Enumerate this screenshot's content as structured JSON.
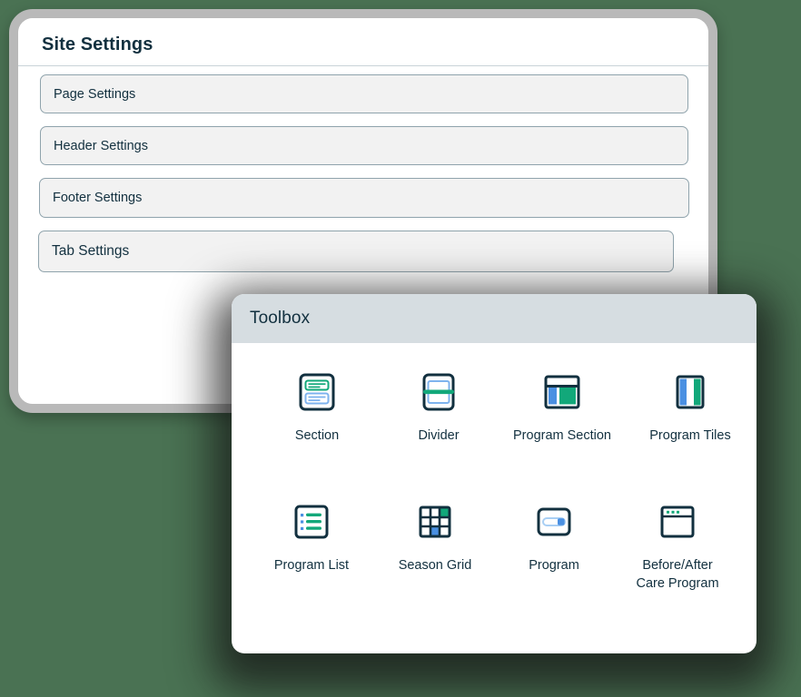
{
  "theme": {
    "page_background": "#4a7253",
    "panel_background": "#ffffff",
    "device_frame": "#b9b9b9",
    "toolbox_header_background": "#d6dde1",
    "text_dark": "#12303f",
    "button_background": "#f2f2f2",
    "button_border": "#8fa3ac",
    "accent_green": "#12a87a",
    "accent_blue": "#4a90e2",
    "icon_outline": "#12303f"
  },
  "site_settings": {
    "title": "Site Settings",
    "items": [
      {
        "label": "Page Settings",
        "name": "page-settings"
      },
      {
        "label": "Header Settings",
        "name": "header-settings"
      },
      {
        "label": "Footer Settings",
        "name": "footer-settings"
      },
      {
        "label": "Tab Settings",
        "name": "tab-settings"
      }
    ]
  },
  "toolbox": {
    "title": "Toolbox",
    "rows": [
      {
        "tools": [
          {
            "label": "Section",
            "icon": "section-icon"
          },
          {
            "label": "Divider",
            "icon": "divider-icon"
          },
          {
            "label": "Program Section",
            "icon": "program-section-icon"
          },
          {
            "label": "Program Tiles",
            "icon": "program-tiles-icon"
          }
        ]
      },
      {
        "tools": [
          {
            "label": "Program List",
            "icon": "program-list-icon"
          },
          {
            "label": "Season Grid",
            "icon": "season-grid-icon"
          },
          {
            "label": "Program",
            "icon": "program-icon"
          },
          {
            "label": "Before/After\nCare Program",
            "icon": "before-after-care-program-icon"
          }
        ]
      }
    ]
  }
}
